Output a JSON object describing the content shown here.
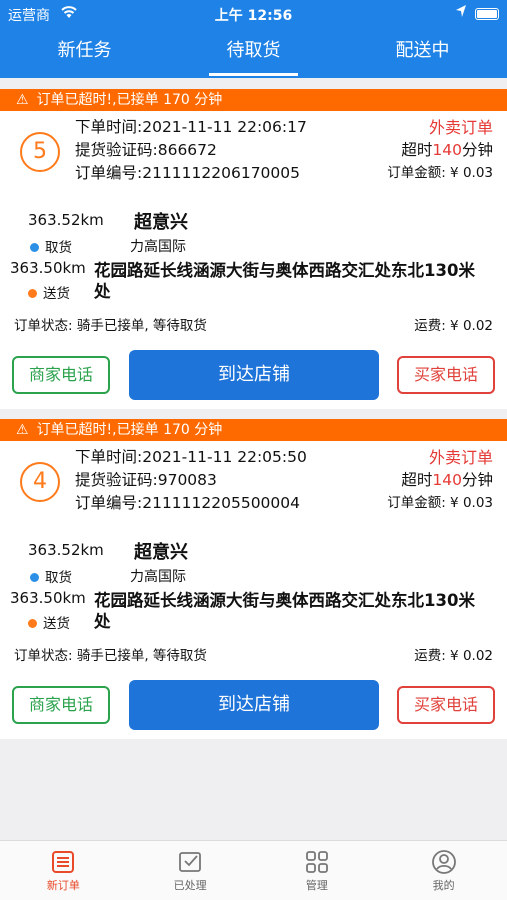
{
  "status_bar": {
    "carrier": "运营商",
    "time": "上午 12:56"
  },
  "tabs": [
    {
      "label": "新任务"
    },
    {
      "label": "待取货"
    },
    {
      "label": "配送中"
    }
  ],
  "orders": [
    {
      "alert": "订单已超时!,已接单 170 分钟",
      "seq": "5",
      "order_time": "下单时间:2021-11-11 22:06:17",
      "pickup_code": "提货验证码:866672",
      "order_no": "订单编号:2111112206170005",
      "type": "外卖订单",
      "overtime_prefix": "超时",
      "overtime_value": "140",
      "overtime_suffix": "分钟",
      "amount": "订单金额: ¥ 0.03",
      "pickup_distance": "363.52km",
      "shop_name": "超意兴",
      "pickup_tag": "取货",
      "pickup_place": "力高国际",
      "deliver_distance": "363.50km",
      "deliver_tag": "送货",
      "deliver_address": "花园路延长线涵源大街与奥体西路交汇处东北130米处",
      "status": "订单状态: 骑手已接单, 等待取货",
      "fee": "运费: ¥ 0.02",
      "btn_merchant": "商家电话",
      "btn_arrive": "到达店铺",
      "btn_buyer": "买家电话"
    },
    {
      "alert": "订单已超时!,已接单 170 分钟",
      "seq": "4",
      "order_time": "下单时间:2021-11-11 22:05:50",
      "pickup_code": "提货验证码:970083",
      "order_no": "订单编号:2111112205500004",
      "type": "外卖订单",
      "overtime_prefix": "超时",
      "overtime_value": "140",
      "overtime_suffix": "分钟",
      "amount": "订单金额: ¥ 0.03",
      "pickup_distance": "363.52km",
      "shop_name": "超意兴",
      "pickup_tag": "取货",
      "pickup_place": "力高国际",
      "deliver_distance": "363.50km",
      "deliver_tag": "送货",
      "deliver_address": "花园路延长线涵源大街与奥体西路交汇处东北130米处",
      "status": "订单状态: 骑手已接单, 等待取货",
      "fee": "运费: ¥ 0.02",
      "btn_merchant": "商家电话",
      "btn_arrive": "到达店铺",
      "btn_buyer": "买家电话"
    }
  ],
  "bottom_nav": [
    {
      "label": "新订单",
      "icon": "list-icon"
    },
    {
      "label": "已处理",
      "icon": "check-box-icon"
    },
    {
      "label": "管理",
      "icon": "grid-icon"
    },
    {
      "label": "我的",
      "icon": "user-icon"
    }
  ],
  "colors": {
    "brand_blue": "#1e82e6",
    "alert_orange": "#ff6a00",
    "accent_red": "#e53935",
    "merchant_green": "#2ba24c",
    "pickup_dot": "#2b8fe6",
    "deliver_dot": "#ff7a1a"
  }
}
